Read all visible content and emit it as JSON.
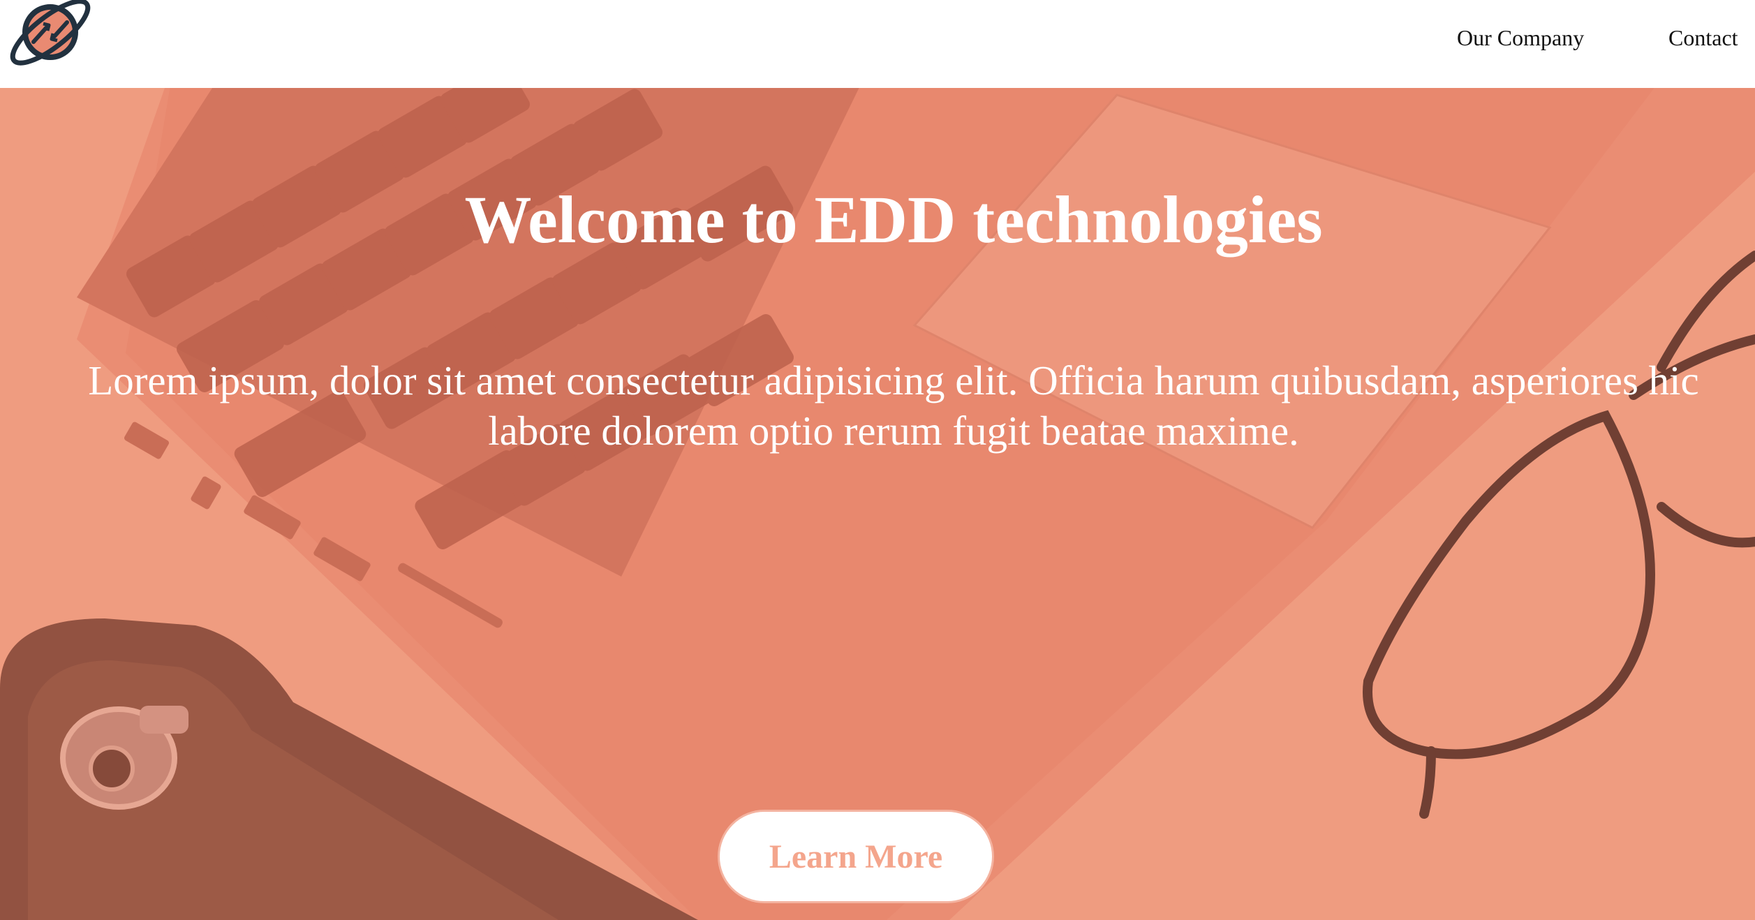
{
  "header": {
    "logo_icon": "planet-sync-icon",
    "nav": [
      {
        "label": "Our Company"
      },
      {
        "label": "Contact"
      }
    ]
  },
  "hero": {
    "title": "Welcome to EDD technologies",
    "text_lines": [
      "Lorem ipsum, dolor sit amet consectetur adipisicing elit. Officia harum quibusdam, asperiores hic",
      "labore dolorem optio rerum fugit beatae maxime."
    ],
    "cta_label": "Learn More",
    "background_icon": "laptop-desk-photo",
    "colors": {
      "overlay": "#ec9378",
      "cta_text": "#f4a58c",
      "cta_border": "#f4b3a0"
    }
  }
}
